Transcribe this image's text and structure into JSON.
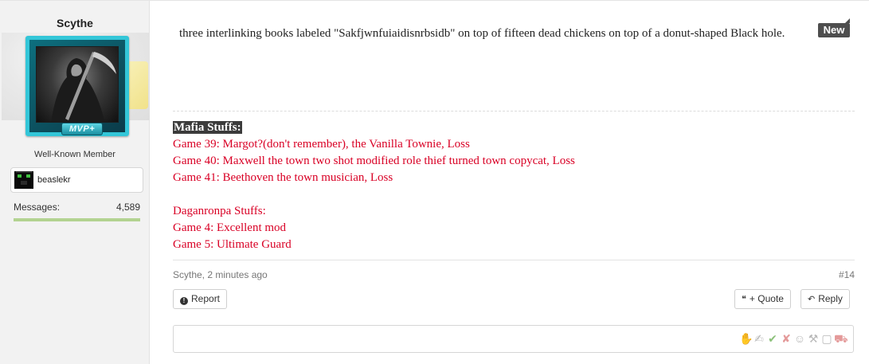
{
  "user": {
    "name": "Scythe",
    "badge": "MVP+",
    "title": "Well-Known Member",
    "linked_account": "beaslekr",
    "messages_label": "Messages:",
    "messages_count": "4,589"
  },
  "post": {
    "new_badge": "New",
    "body": "three interlinking books labeled \"Sakfjwnfuiaidisnrbsidb\" on top of fifteen dead chickens on top of a donut-shaped Black hole.",
    "signature": {
      "heading": "Mafia Stuffs:",
      "mafia_lines": [
        "Game 39: Margot?(don't remember), the Vanilla Townie, Loss",
        "Game 40: Maxwell the town two shot modified role thief turned town copycat, Loss",
        "Game 41: Beethoven the town musician, Loss"
      ],
      "danganronpa_heading": "Daganronpa Stuffs:",
      "danganronpa_lines": [
        "Game 4: Excellent mod",
        "Game 5: Ultimate Guard"
      ]
    },
    "meta": {
      "author_time": "Scythe, 2 minutes ago",
      "post_number": "#14"
    },
    "actions": {
      "report": "Report",
      "quote": "+ Quote",
      "reply": "Reply"
    }
  },
  "colors": {
    "signature_red": "#d90025",
    "avatar_frame": "#33c6d8",
    "messages_bar": "#b3d391"
  },
  "reaction_icons": [
    "thumbs-up-icon",
    "thumbs-down-icon",
    "check-icon",
    "x-icon",
    "smile-icon",
    "tools-icon",
    "box-icon",
    "truck-icon"
  ]
}
